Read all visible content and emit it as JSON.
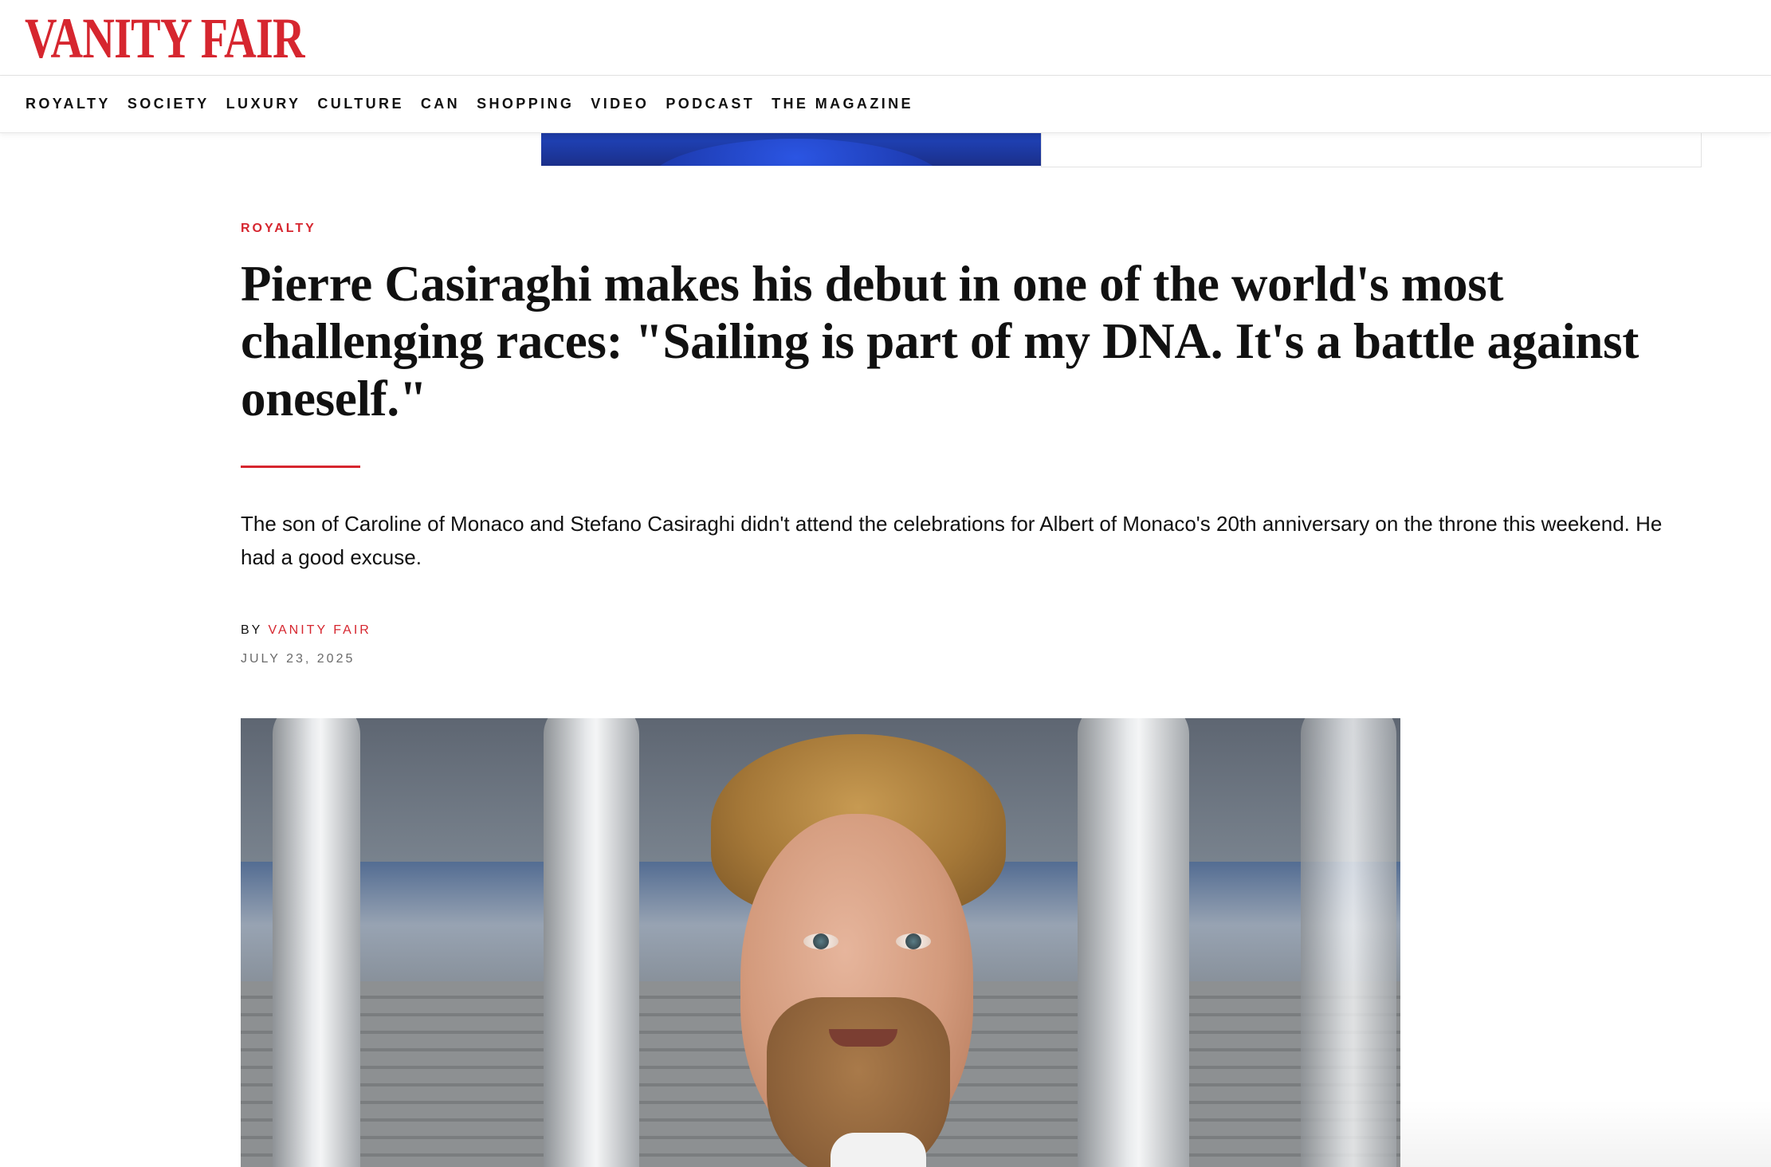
{
  "site": {
    "logo_text": "VANITY FAIR",
    "brand_color": "#d6262f"
  },
  "nav": {
    "items": [
      "ROYALTY",
      "SOCIETY",
      "LUXURY",
      "CULTURE",
      "CAN",
      "SHOPPING",
      "VIDEO",
      "PODCAST",
      "THE MAGAZINE"
    ]
  },
  "article": {
    "rubric": "ROYALTY",
    "headline": "Pierre Casiraghi makes his debut in one of the world's most challenging races: \"Sailing is part of my DNA. It's a battle against oneself.\"",
    "dek": "The son of Caroline of Monaco and Stefano Casiraghi didn't attend the celebrations for Albert of Monaco's 20th anniversary on the throne this weekend. He had a good excuse.",
    "byline_prefix": "BY",
    "author": "VANITY FAIR",
    "date": "JULY 23, 2025"
  }
}
